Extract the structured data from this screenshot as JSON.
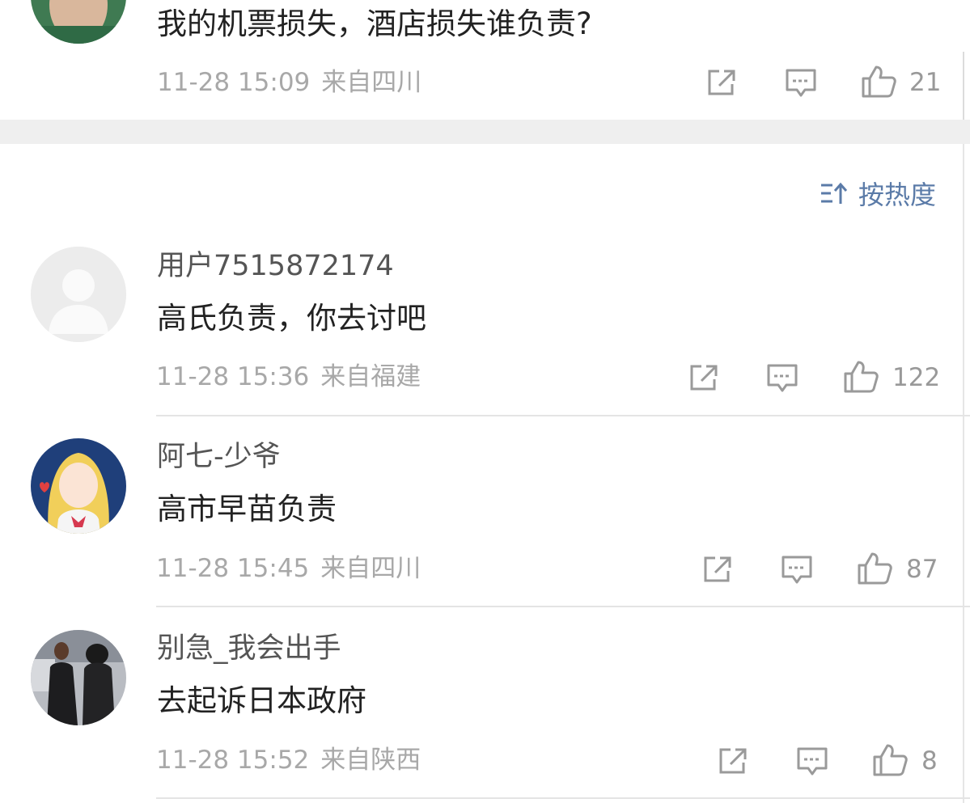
{
  "top_comment": {
    "text": "我的机票损失，酒店损失谁负责?",
    "time": "11-28 15:09",
    "location": "来自四川",
    "likes": "21"
  },
  "sort": {
    "label": "按热度"
  },
  "comments": [
    {
      "username": "用户7515872174",
      "text": "高氏负责，你去讨吧",
      "time": "11-28 15:36",
      "location": "来自福建",
      "likes": "122"
    },
    {
      "username": "阿七-少爷",
      "text": "高市早苗负责",
      "time": "11-28 15:45",
      "location": "来自四川",
      "likes": "87"
    },
    {
      "username": "别急_我会出手",
      "text": "去起诉日本政府",
      "time": "11-28 15:52",
      "location": "来自陕西",
      "likes": "8"
    }
  ],
  "colors": {
    "link_blue": "#5b7ba8",
    "meta_gray": "#a8a8a8",
    "divider": "#e4e4e4",
    "band": "#efefef"
  },
  "icons": [
    "share-icon",
    "comment-icon",
    "like-icon",
    "sort-icon"
  ]
}
